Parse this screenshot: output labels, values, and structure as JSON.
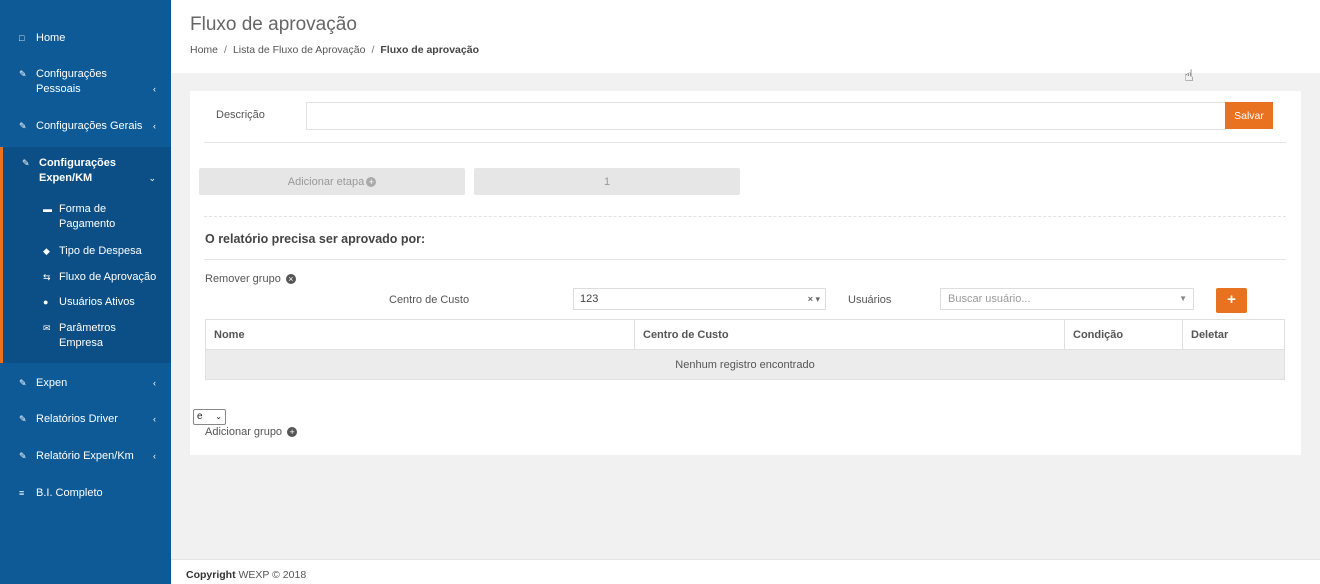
{
  "sidebar": {
    "items": [
      {
        "label": "Home",
        "icon": "laptop-icon"
      },
      {
        "label": "Configurações Pessoais",
        "icon": "edit-icon"
      },
      {
        "label": "Configurações Gerais",
        "icon": "edit-icon"
      },
      {
        "label": "Configurações Expen/KM",
        "icon": "edit-icon"
      },
      {
        "label": "Expen",
        "icon": "edit-icon"
      },
      {
        "label": "Relatórios Driver",
        "icon": "edit-icon"
      },
      {
        "label": "Relatório Expen/Km",
        "icon": "edit-icon"
      },
      {
        "label": "B.I. Completo",
        "icon": "list-icon"
      }
    ],
    "subitems": [
      {
        "label": "Forma de Pagamento",
        "icon": "credit-card-icon"
      },
      {
        "label": "Tipo de Despesa",
        "icon": "tag-icon"
      },
      {
        "label": "Fluxo de Aprovação",
        "icon": "retweet-icon"
      },
      {
        "label": "Usuários Ativos",
        "icon": "user-icon"
      },
      {
        "label": "Parâmetros Empresa",
        "icon": "envelope-icon"
      }
    ]
  },
  "header": {
    "title": "Fluxo de aprovação",
    "breadcrumb": [
      "Home",
      "Lista de Fluxo de Aprovação",
      "Fluxo de aprovação"
    ],
    "breadcrumb_sep": "/"
  },
  "form": {
    "description_label": "Descrição",
    "description_value": "",
    "save_label": "Salvar",
    "add_stage_label": "Adicionar etapa",
    "stage_number": "1",
    "section_title": "O relatório precisa ser aprovado por:",
    "remove_group_label": "Remover grupo",
    "cost_center_label": "Centro de Custo",
    "cost_center_value": "123",
    "users_label": "Usuários",
    "users_placeholder": "Buscar usuário...",
    "add_button": "+",
    "logic_select_value": "e",
    "add_group_label": "Adicionar grupo"
  },
  "table": {
    "headers": [
      "Nome",
      "Centro de Custo",
      "Condição",
      "Deletar"
    ],
    "empty_text": "Nenhum registro encontrado"
  },
  "footer": {
    "copyright_label": "Copyright",
    "copyright_text": "WEXP © 2018"
  },
  "colors": {
    "sidebar": "#0d5a97",
    "accent": "#e8721f"
  }
}
